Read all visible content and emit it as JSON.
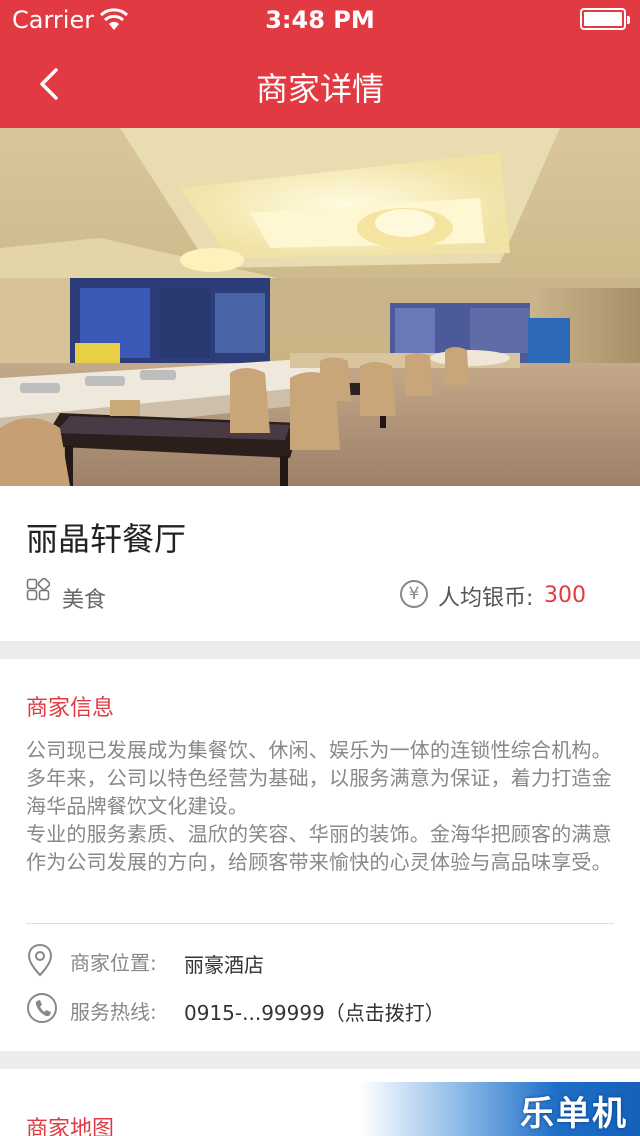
{
  "status_bar": {
    "carrier": "Carrier",
    "time": "3:48 PM"
  },
  "nav": {
    "title": "商家详情",
    "back_icon": "chevron-left-icon"
  },
  "banner": {
    "slides": 2,
    "active_index": 0
  },
  "shop": {
    "name": "丽晶轩餐厅",
    "category": "美食",
    "avg_label": "人均银币:",
    "avg_value": "300",
    "coin_symbol": "¥"
  },
  "info": {
    "section_title": "商家信息",
    "paragraphs": [
      "公司现已发展成为集餐饮、休闲、娱乐为一体的连锁性综合机构。多年来，公司以特色经营为基础，以服务满意为保证，着力打造金海华品牌餐饮文化建设。",
      "专业的服务素质、温欣的笑容、华丽的装饰。金海华把顾客的满意作为公司发展的方向，给顾客带来愉快的心灵体验与高品味享受。"
    ],
    "location_label": "商家位置:",
    "location_value": "丽豪酒店",
    "hotline_label": "服务热线:",
    "hotline_value": "0915-...99999（点击拨打）"
  },
  "map": {
    "section_title": "商家地图"
  },
  "watermark": "乐单机",
  "colors": {
    "accent": "#e23a42",
    "background": "#ececec"
  }
}
